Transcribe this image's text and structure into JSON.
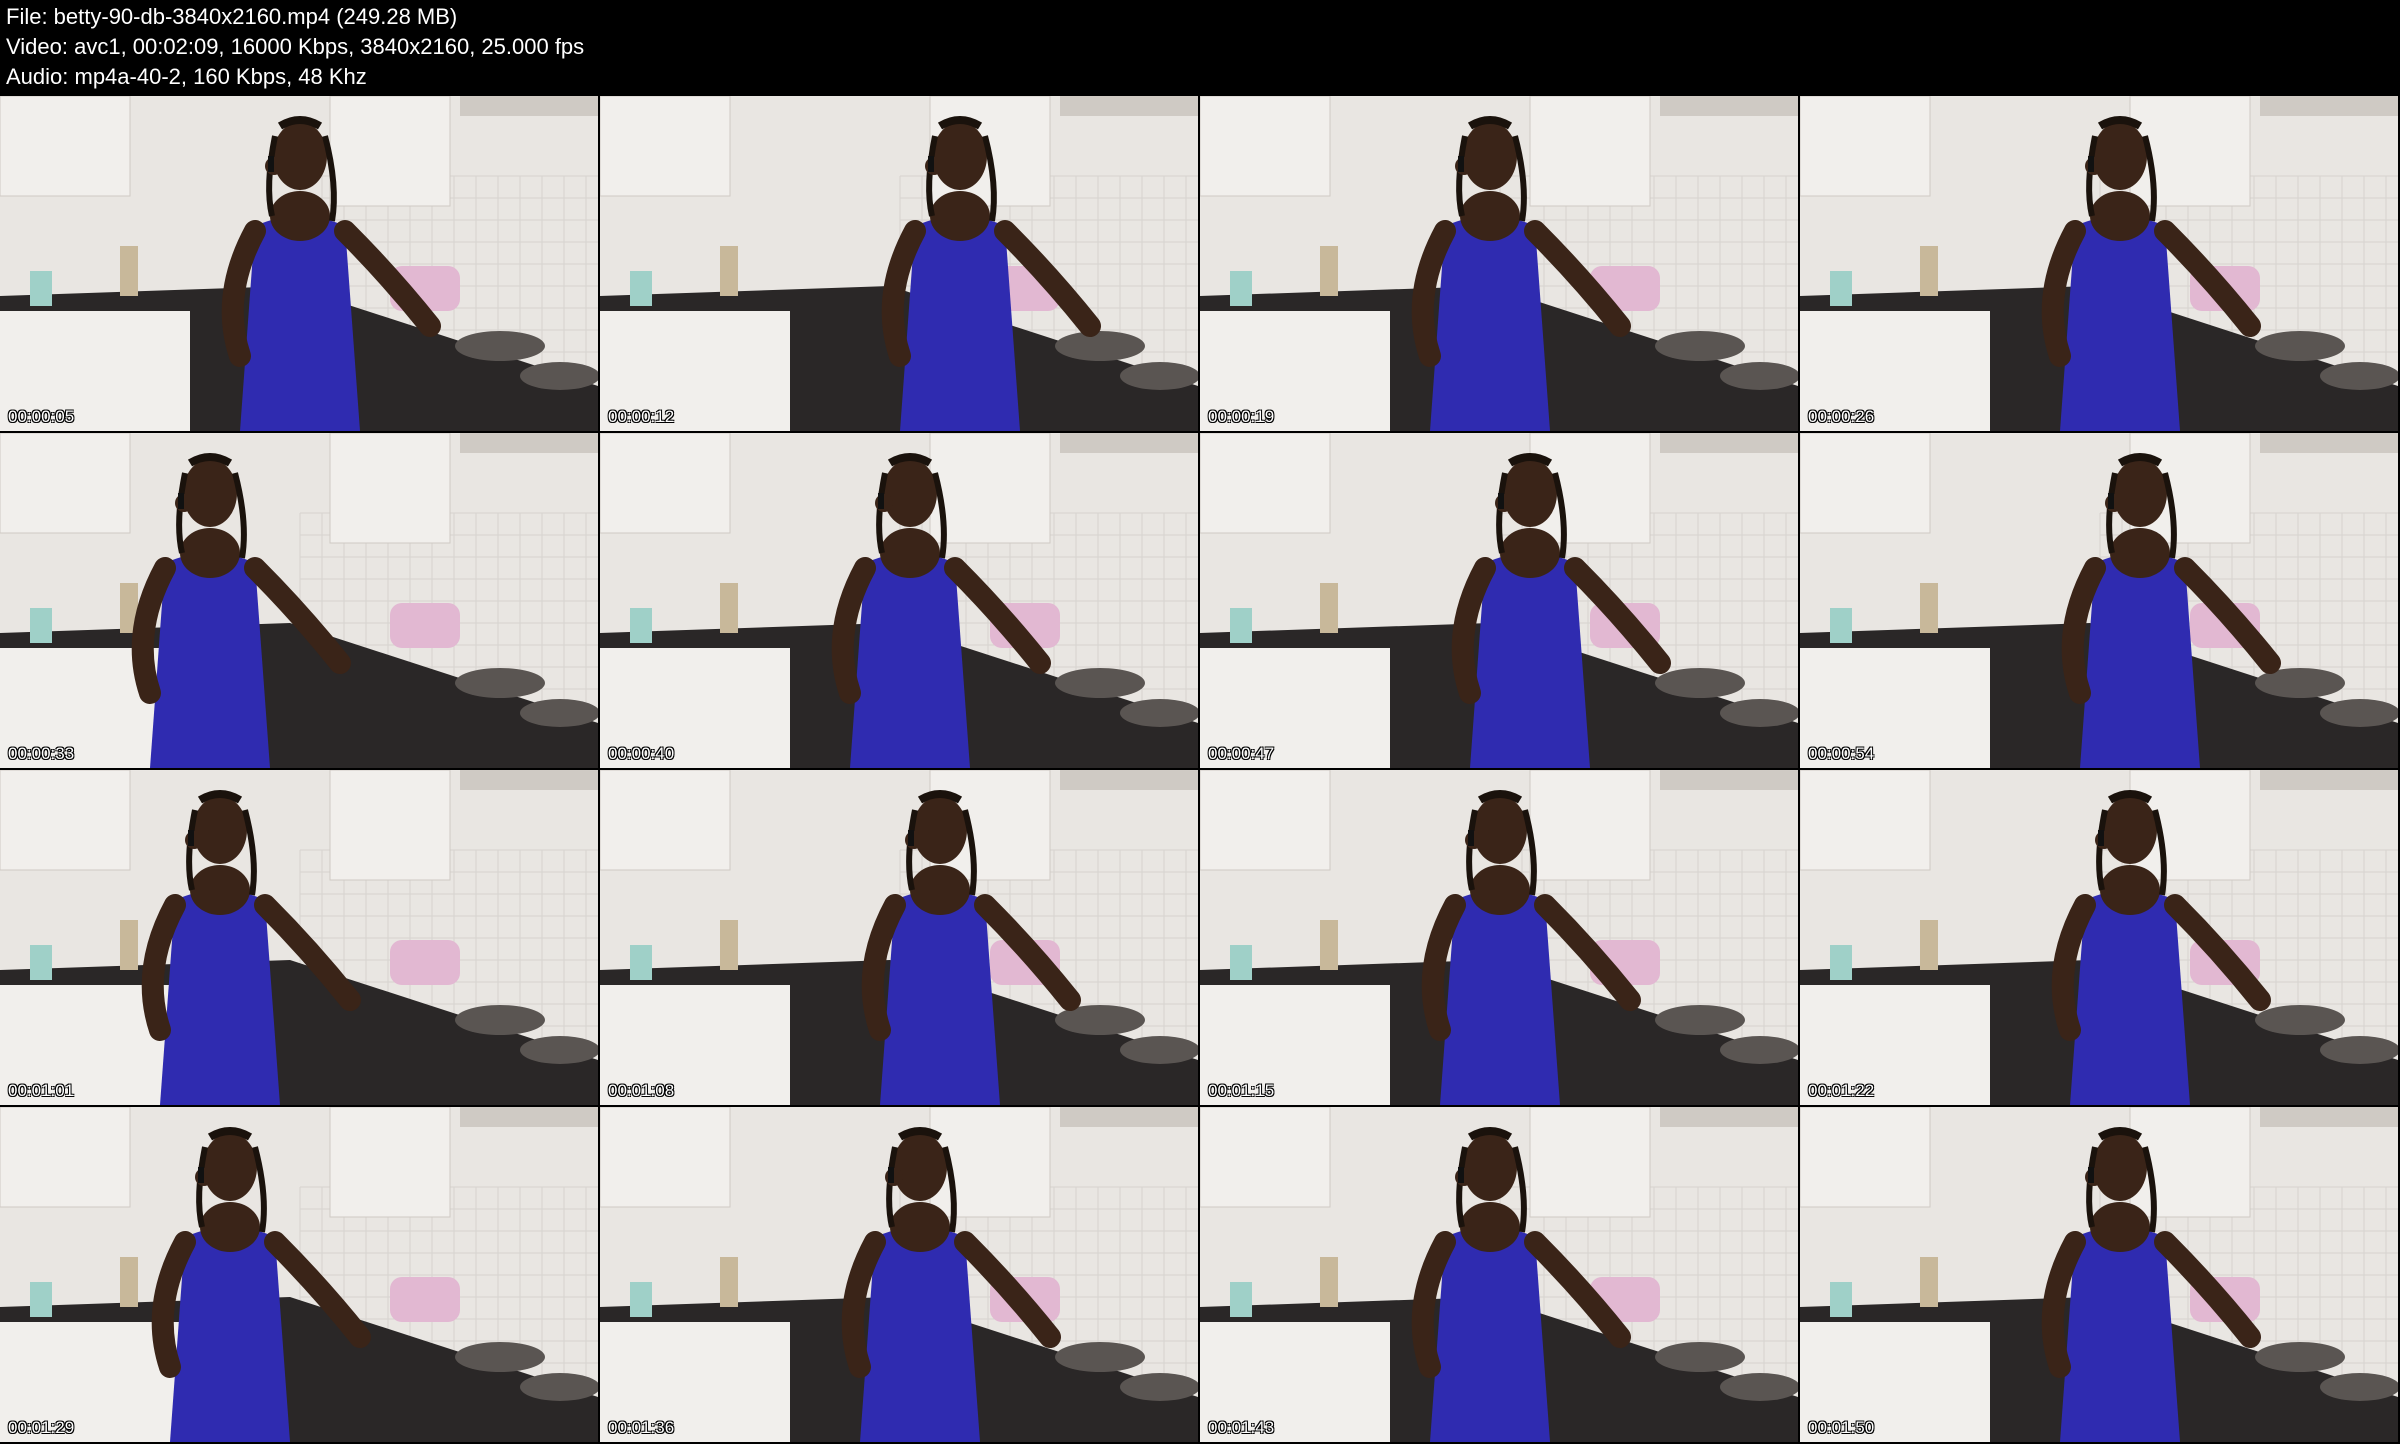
{
  "header": {
    "file_line": "File: betty-90-db-3840x2160.mp4 (249.28 MB)",
    "video_line": "Video: avc1, 00:02:09, 16000 Kbps, 3840x2160, 25.000 fps",
    "audio_line": "Audio: mp4a-40-2, 160 Kbps, 48 Khz"
  },
  "thumbnails": [
    {
      "timestamp": "00:00:05"
    },
    {
      "timestamp": "00:00:12"
    },
    {
      "timestamp": "00:00:19"
    },
    {
      "timestamp": "00:00:26"
    },
    {
      "timestamp": "00:00:33"
    },
    {
      "timestamp": "00:00:40"
    },
    {
      "timestamp": "00:00:47"
    },
    {
      "timestamp": "00:00:54"
    },
    {
      "timestamp": "00:01:01"
    },
    {
      "timestamp": "00:01:08"
    },
    {
      "timestamp": "00:01:15"
    },
    {
      "timestamp": "00:01:22"
    },
    {
      "timestamp": "00:01:29"
    },
    {
      "timestamp": "00:01:36"
    },
    {
      "timestamp": "00:01:43"
    },
    {
      "timestamp": "00:01:50"
    }
  ],
  "colors": {
    "background": "#000000",
    "text": "#ffffff",
    "wall": "#e9e6e2",
    "tile": "#f4f3f1",
    "cabinet": "#f1efec",
    "counter": "#2a2727",
    "jumpsuit": "#2f2bb0",
    "skin": "#3a2418",
    "toaster": "#e2b8d2"
  }
}
